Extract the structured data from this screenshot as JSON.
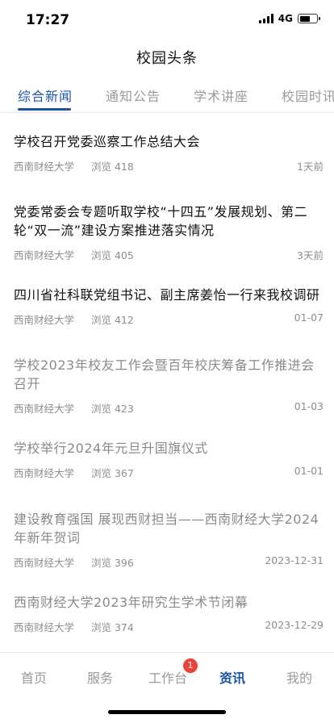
{
  "status": {
    "time": "17:27",
    "network": "4G"
  },
  "header": {
    "title": "校园头条"
  },
  "tabs": [
    {
      "label": "综合新闻",
      "active": true
    },
    {
      "label": "通知公告",
      "active": false
    },
    {
      "label": "学术讲座",
      "active": false
    },
    {
      "label": "校园时讯",
      "active": false
    }
  ],
  "news": [
    {
      "title": "学校召开党委巡察工作总结大会",
      "source": "西南财经大学",
      "views": "浏览 418",
      "date": "1天前",
      "read": false
    },
    {
      "title": "党委常委会专题听取学校“十四五”发展规划、第二轮“双一流”建设方案推进落实情况",
      "source": "西南财经大学",
      "views": "浏览 405",
      "date": "3天前",
      "read": false
    },
    {
      "title": "四川省社科联党组书记、副主席姜怡一行来我校调研",
      "source": "西南财经大学",
      "views": "浏览 412",
      "date": "01-07",
      "read": false
    },
    {
      "title": "学校2023年校友工作会暨百年校庆筹备工作推进会召开",
      "source": "西南财经大学",
      "views": "浏览 423",
      "date": "01-03",
      "read": true
    },
    {
      "title": "学校举行2024年元旦升国旗仪式",
      "source": "西南财经大学",
      "views": "浏览 367",
      "date": "01-01",
      "read": true
    },
    {
      "title": "建设教育强国 展现西财担当——西南财经大学2024年新年贺词",
      "source": "西南财经大学",
      "views": "浏览 396",
      "date": "2023-12-31",
      "read": true
    },
    {
      "title": "西南财经大学2023年研究生学术节闭幕",
      "source": "西南财经大学",
      "views": "浏览 374",
      "date": "2023-12-29",
      "read": true
    }
  ],
  "tabbar": {
    "items": [
      {
        "label": "首页"
      },
      {
        "label": "服务"
      },
      {
        "label": "工作台"
      },
      {
        "label": "资讯"
      },
      {
        "label": "我的"
      }
    ],
    "badge": "1"
  },
  "colors": {
    "accent": "#1c55a8",
    "badge": "#e8433a",
    "muted": "#9a9a9a"
  }
}
